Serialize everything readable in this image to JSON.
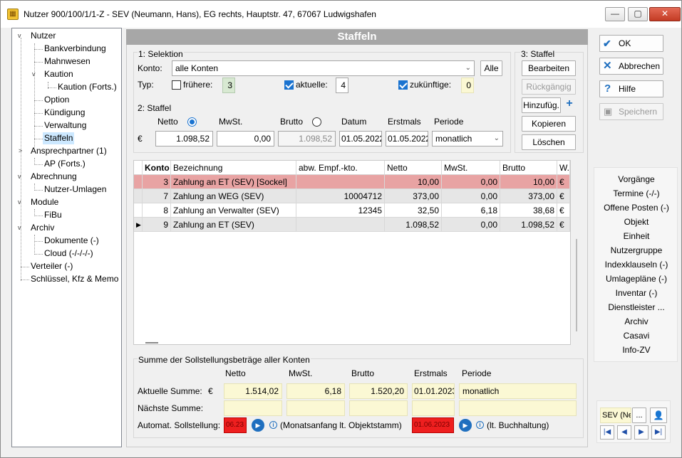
{
  "window": {
    "title": "Nutzer 900/100/1/1-Z - SEV (Neumann, Hans), EG rechts, Hauptstr. 47, 67067 Ludwigshafen"
  },
  "tree": [
    {
      "label": "Nutzer",
      "toggle": "v"
    },
    {
      "label": "Bankverbindung"
    },
    {
      "label": "Mahnwesen"
    },
    {
      "label": "Kaution",
      "toggle": "v"
    },
    {
      "label": "Kaution (Forts.)"
    },
    {
      "label": "Option"
    },
    {
      "label": "Kündigung"
    },
    {
      "label": "Verwaltung"
    },
    {
      "label": "Staffeln"
    },
    {
      "label": "Ansprechpartner (1)",
      "toggle": ">"
    },
    {
      "label": "AP (Forts.)"
    },
    {
      "label": "Abrechnung",
      "toggle": "v"
    },
    {
      "label": "Nutzer-Umlagen"
    },
    {
      "label": "Module",
      "toggle": "v"
    },
    {
      "label": "FiBu"
    },
    {
      "label": "Archiv",
      "toggle": "v"
    },
    {
      "label": "Dokumente (-)"
    },
    {
      "label": "Cloud (-/-/-/-)"
    },
    {
      "label": "Verteiler (-)"
    },
    {
      "label": "Schlüssel, Kfz & Memo"
    }
  ],
  "header": {
    "title": "Staffeln"
  },
  "selektion": {
    "title": "1: Selektion",
    "konto_label": "Konto:",
    "konto_value": "alle Konten",
    "alle_button": "Alle",
    "typ_label": "Typ:",
    "fruehere_label": "frühere:",
    "fruehere_count": "3",
    "aktuelle_label": "aktuelle:",
    "aktuelle_count": "4",
    "zukuenftige_label": "zukünftige:",
    "zukuenftige_count": "0"
  },
  "staffel_edit": {
    "title": "2: Staffel",
    "netto_label": "Netto",
    "mwst_label": "MwSt.",
    "brutto_label": "Brutto",
    "datum_label": "Datum",
    "erstmals_label": "Erstmals",
    "periode_label": "Periode",
    "currency": "€",
    "netto_value": "1.098,52",
    "mwst_value": "0,00",
    "brutto_value": "1.098,52",
    "datum_value": "01.05.2022",
    "erstmals_value": "01.05.2022",
    "periode_value": "monatlich"
  },
  "staffel_actions": {
    "title": "3: Staffel",
    "bearbeiten": "Bearbeiten",
    "rueckgaengig": "Rückgängig",
    "hinzufuegen": "Hinzufüg.",
    "kopieren": "Kopieren",
    "loeschen": "Löschen"
  },
  "grid": {
    "columns": [
      "Konto",
      "Bezeichnung",
      "abw. Empf.-kto.",
      "Netto",
      "MwSt.",
      "Brutto",
      "W."
    ],
    "rows": [
      {
        "konto": "3",
        "bez": "Zahlung an ET (SEV) [Sockel]",
        "empf": "",
        "netto": "10,00",
        "mwst": "0,00",
        "brutto": "10,00",
        "w": "€"
      },
      {
        "konto": "7",
        "bez": "Zahlung an WEG (SEV)",
        "empf": "10004712",
        "netto": "373,00",
        "mwst": "0,00",
        "brutto": "373,00",
        "w": "€"
      },
      {
        "konto": "8",
        "bez": "Zahlung an Verwalter (SEV)",
        "empf": "12345",
        "netto": "32,50",
        "mwst": "6,18",
        "brutto": "38,68",
        "w": "€"
      },
      {
        "konto": "9",
        "bez": "Zahlung an ET (SEV)",
        "empf": "",
        "netto": "1.098,52",
        "mwst": "0,00",
        "brutto": "1.098,52",
        "w": "€"
      }
    ]
  },
  "summary": {
    "title": "Summe der Sollstellungsbeträge aller Konten",
    "netto_label": "Netto",
    "mwst_label": "MwSt.",
    "brutto_label": "Brutto",
    "erstmals_label": "Erstmals",
    "periode_label": "Periode",
    "aktuelle_label": "Aktuelle Summe:",
    "currency": "€",
    "netto": "1.514,02",
    "mwst": "6,18",
    "brutto": "1.520,20",
    "erstmals": "01.01.2023",
    "periode": "monatlich",
    "naechste_label": "Nächste Summe:",
    "automat_label": "Automat. Sollstellung:",
    "automat_day": "06.23",
    "automat_note": "(Monatsanfang lt. Objektstamm)",
    "automat_date": "01.06.2023",
    "automat_note2": "(lt. Buchhaltung)"
  },
  "actions": {
    "ok": "OK",
    "abbrechen": "Abbrechen",
    "hilfe": "Hilfe",
    "speichern": "Speichern"
  },
  "nav_links": [
    "Vorgänge",
    "Termine (-/-)",
    "Offene Posten (-)",
    "Objekt",
    "Einheit",
    "Nutzergruppe",
    "Indexklauseln (-)",
    "Umlagepläne (-)",
    "Inventar (-)",
    "Dienstleister ...",
    "Archiv",
    "Casavi",
    "Info-ZV"
  ],
  "footer": {
    "search_value": "SEV (Ne",
    "more": "..."
  }
}
